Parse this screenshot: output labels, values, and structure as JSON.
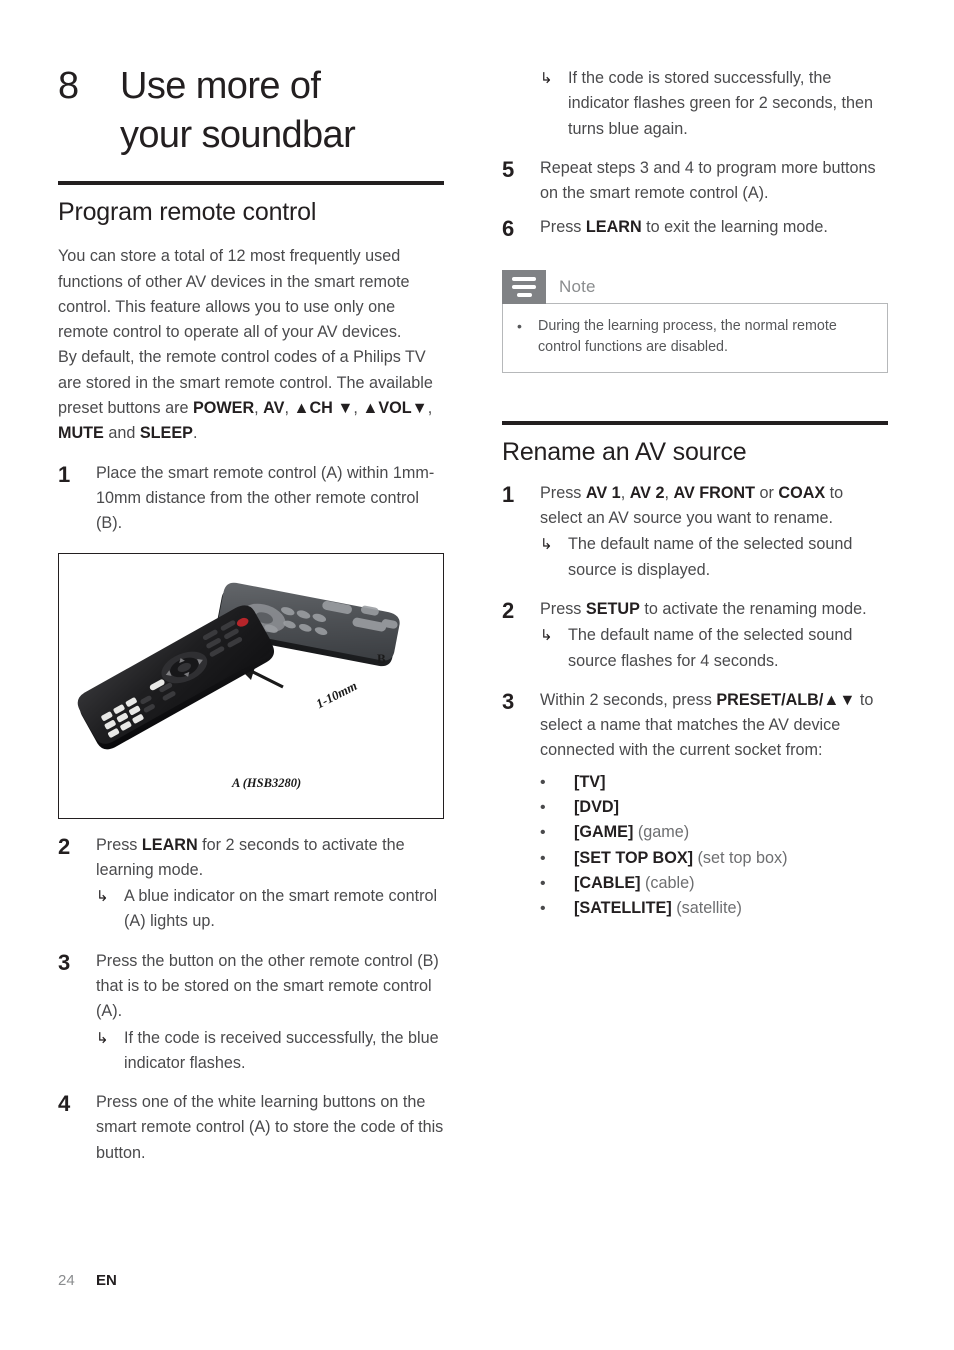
{
  "chapter": {
    "number": "8",
    "title_line1": "Use more of",
    "title_line2": "your soundbar"
  },
  "left_column": {
    "section_title": "Program remote control",
    "intro_paragraph_1": "You can store a total of 12 most frequently used functions of other AV devices in the smart remote control. This feature allows you to use only one remote control to operate all of your AV devices.",
    "intro_paragraph_2_pre": "By default, the remote control codes of a Philips TV are stored in the smart remote control. The available preset buttons are ",
    "preset_power": "POWER",
    "preset_sep1": ", ",
    "preset_av": "AV",
    "preset_sep2": ", ",
    "preset_ch": "▲CH ▼",
    "preset_sep3": ", ",
    "preset_vol": "▲VOL▼",
    "preset_sep4": ", ",
    "preset_mute": "MUTE",
    "preset_and": " and ",
    "preset_sleep": "SLEEP",
    "preset_end": ".",
    "steps": [
      {
        "num": "1",
        "text": "Place the smart remote control (A) within 1mm-10mm distance from the other remote control (B)."
      },
      {
        "num": "2",
        "text_pre": "Press ",
        "bold": "LEARN",
        "text_post": " for 2 seconds to activate the learning mode.",
        "results": [
          "A blue indicator on the smart remote control (A) lights up."
        ]
      },
      {
        "num": "3",
        "text": "Press the button on the other remote control (B) that is to be stored on the smart remote control (A).",
        "results": [
          "If the code is received successfully, the blue indicator flashes."
        ]
      },
      {
        "num": "4",
        "text": "Press one of the white learning buttons on the smart remote control (A) to store the code of this button."
      }
    ],
    "figure": {
      "caption_a": "A (HSB3280)",
      "caption_b": "B",
      "dimension": "1-10mm",
      "alt": "two remote controls pointed at each other"
    }
  },
  "right_column": {
    "orphan_result": "If the code is stored successfully, the indicator flashes green for 2 seconds, then turns blue again.",
    "steps_continued": [
      {
        "num": "5",
        "text": "Repeat steps 3 and 4 to program more buttons on the smart remote control (A)."
      },
      {
        "num": "6",
        "text_pre": "Press ",
        "bold": "LEARN",
        "text_post": " to exit the learning mode."
      }
    ],
    "note": {
      "label": "Note",
      "icon": "note-lines-icon",
      "bullet_glyph": "•",
      "items": [
        "During the learning process, the normal remote control functions are disabled."
      ]
    },
    "section_title": "Rename an AV source",
    "rename_steps": [
      {
        "num": "1",
        "pre": "Press ",
        "b1": "AV 1",
        "s1": ", ",
        "b2": "AV 2",
        "s2": ", ",
        "b3": "AV FRONT",
        "s3": " or ",
        "b4": "COAX",
        "post": " to select an AV source you want to rename.",
        "results": [
          "The default name of the selected sound source is displayed."
        ]
      },
      {
        "num": "2",
        "pre": "Press ",
        "b1": "SETUP",
        "post": " to activate the renaming mode.",
        "results": [
          "The default name of the selected sound source flashes for 4 seconds."
        ]
      },
      {
        "num": "3",
        "pre": "Within 2 seconds, press ",
        "b1": "PRESET/ALB/▲▼",
        "post": " to select a name that matches the AV device connected with the current socket from:"
      }
    ],
    "source_names": [
      {
        "name": "[TV]",
        "note": ""
      },
      {
        "name": "[DVD]",
        "note": ""
      },
      {
        "name": "[GAME]",
        "note": " (game)"
      },
      {
        "name": "[SET TOP BOX]",
        "note": " (set top box)"
      },
      {
        "name": "[CABLE]",
        "note": " (cable)"
      },
      {
        "name": "[SATELLITE]",
        "note": " (satellite)"
      }
    ],
    "bullet_glyph": "•"
  },
  "arrow_glyph": "↳",
  "footer": {
    "page_number": "24",
    "language": "EN"
  },
  "colors": {
    "text": "#4a4a4c",
    "heading": "#231f20",
    "rule": "#231f20",
    "note_gray": "#808285",
    "note_border": "#b6b8ba"
  }
}
